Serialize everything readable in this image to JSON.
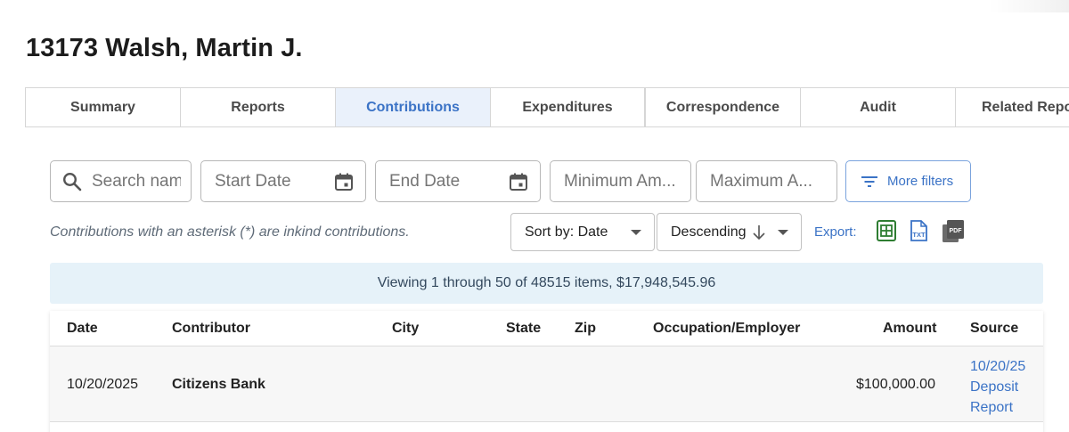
{
  "page": {
    "title": "13173 Walsh, Martin J."
  },
  "tabs": [
    {
      "label": "Summary",
      "active": false
    },
    {
      "label": "Reports",
      "active": false
    },
    {
      "label": "Contributions",
      "active": true
    },
    {
      "label": "Expenditures",
      "active": false
    },
    {
      "label": "Correspondence",
      "active": false
    },
    {
      "label": "Audit",
      "active": false
    },
    {
      "label": "Related Repor",
      "active": false
    }
  ],
  "filters": {
    "search_placeholder": "Search nam",
    "start_date_placeholder": "Start Date",
    "end_date_placeholder": "End Date",
    "min_amount_placeholder": "Minimum Am...",
    "max_amount_placeholder": "Maximum A...",
    "more_filters_label": "More filters"
  },
  "note": "Contributions with an asterisk (*) are inkind contributions.",
  "sort": {
    "sort_by_label": "Sort by: Date",
    "order_label": "Descending"
  },
  "export": {
    "label": "Export:",
    "icons": [
      "excel-icon",
      "txt-icon",
      "pdf-icon"
    ]
  },
  "summary": {
    "text": "Viewing 1 through 50 of 48515 items, $17,948,545.96"
  },
  "table": {
    "headers": [
      "Date",
      "Contributor",
      "City",
      "State",
      "Zip",
      "Occupation/Employer",
      "Amount",
      "Source"
    ],
    "rows": [
      {
        "date": "10/20/2025",
        "contributor": "Citizens Bank",
        "city": "",
        "state": "",
        "zip": "",
        "occupation": "",
        "amount": "$100,000.00",
        "source": "10/20/25 Deposit Report"
      }
    ]
  },
  "colors": {
    "accent": "#3b73c6",
    "active_tab_bg": "#eaf1fb",
    "banner_bg": "#e6f2f9",
    "excel_green": "#2e7d32"
  }
}
